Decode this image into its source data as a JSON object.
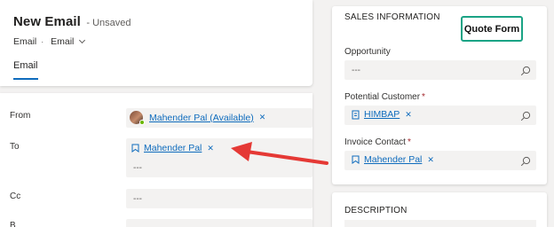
{
  "header": {
    "title": "New Email",
    "status": "- Unsaved",
    "entity": "Email",
    "separator": "·",
    "form_selector": "Email",
    "tab": "Email"
  },
  "form": {
    "from": {
      "label": "From",
      "value": "Mahender Pal (Available)"
    },
    "to": {
      "label": "To",
      "value": "Mahender Pal",
      "empty": "---"
    },
    "cc": {
      "label": "Cc",
      "empty": "---"
    },
    "bcc": {
      "label": "B"
    }
  },
  "sales_info": {
    "title": "SALES INFORMATION",
    "opportunity": {
      "label": "Opportunity",
      "empty": "---"
    },
    "potential_customer": {
      "label": "Potential Customer",
      "required": "*",
      "value": "HIMBAP"
    },
    "invoice_contact": {
      "label": "Invoice Contact",
      "required": "*",
      "value": "Mahender Pal"
    }
  },
  "description": {
    "title": "DESCRIPTION"
  },
  "annotation": {
    "label": "Quote Form",
    "border_color": "#1aa385",
    "arrow_color": "#e53935"
  },
  "colors": {
    "link": "#0f6cbd",
    "required": "#a4262c",
    "presence": "#6bb700"
  }
}
